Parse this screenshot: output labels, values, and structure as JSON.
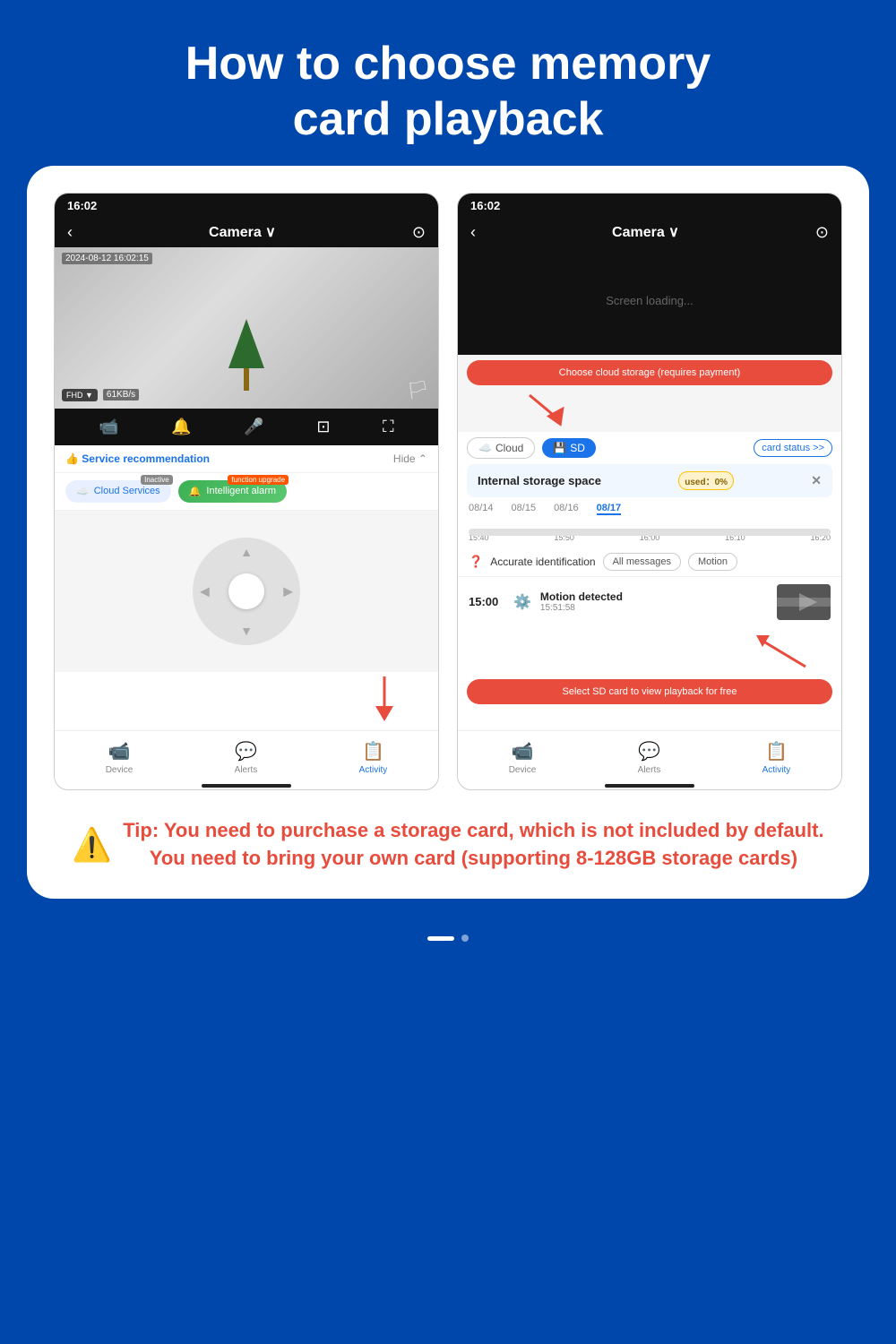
{
  "page": {
    "title_line1": "How to choose memory",
    "title_line2": "card playback",
    "background_color": "#0047ab"
  },
  "left_phone": {
    "status_time": "16:02",
    "nav_title": "Camera",
    "nav_chevron": "∨",
    "timestamp": "2024-08-12 16:02:15",
    "quality": "FHD",
    "bitrate": "61KB/s",
    "service_label": "Service recommendation",
    "hide_label": "Hide ⌃",
    "cloud_services_label": "Cloud Services",
    "cloud_inactive": "Inactive",
    "alarm_label": "Intelligent alarm",
    "alarm_upgrade": "function upgrade",
    "bottom_nav": [
      {
        "label": "Device",
        "icon": "📹",
        "active": false
      },
      {
        "label": "Alerts",
        "icon": "💬",
        "active": false
      },
      {
        "label": "Activity",
        "icon": "📋",
        "active": true
      }
    ]
  },
  "right_phone": {
    "status_time": "16:02",
    "nav_title": "Camera",
    "screen_loading": "Screen loading...",
    "cloud_callout": "Choose cloud storage (requires payment)",
    "tab_cloud": "Cloud",
    "tab_sd": "SD",
    "card_status": "card status >>",
    "storage_label": "Internal storage space",
    "used_label": "used：0%",
    "dates": [
      "08/14",
      "08/15",
      "08/16",
      "08/17"
    ],
    "timeline_labels": [
      "15:40",
      "15:50",
      "16:00",
      "16:10",
      "16:20"
    ],
    "filter_label": "Accurate identification",
    "filter_all": "All messages",
    "filter_motion": "Motion",
    "event_time": "15:00",
    "event_title": "Motion detected",
    "event_sub": "15:51:58",
    "sd_callout": "Select SD card to view playback for free",
    "bottom_nav": [
      {
        "label": "Device",
        "icon": "📹",
        "active": false
      },
      {
        "label": "Alerts",
        "icon": "💬",
        "active": false
      },
      {
        "label": "Activity",
        "icon": "📋",
        "active": true
      }
    ]
  },
  "tip": {
    "icon": "⚠️",
    "text": "Tip: You need to purchase a storage card, which is not included by default. You need to bring your own card (supporting 8-128GB storage cards)"
  },
  "page_indicator": {
    "active_dot": "—",
    "inactive_dot": "•"
  }
}
